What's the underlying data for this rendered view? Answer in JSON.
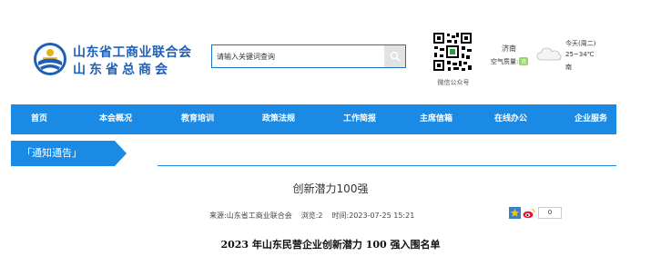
{
  "header": {
    "org_name_line1": "山东省工商业联合会",
    "org_name_line2": "山东省总商会"
  },
  "search": {
    "placeholder": "请输入关键词查询"
  },
  "qr": {
    "caption": "微信公众号"
  },
  "weather": {
    "city": "济南",
    "air_quality_label": "空气质量:",
    "air_quality_value": "良",
    "day": "今天(周二)",
    "temperature": "25~34℃",
    "wind": "南"
  },
  "nav": {
    "items": [
      {
        "label": "首页"
      },
      {
        "label": "本会概况"
      },
      {
        "label": "教育培训"
      },
      {
        "label": "政策法规"
      },
      {
        "label": "工作简报"
      },
      {
        "label": "主席信箱"
      },
      {
        "label": "在线办公"
      },
      {
        "label": "企业服务"
      }
    ]
  },
  "section": {
    "label": "「通知通告」"
  },
  "article": {
    "title": "创新潜力100强",
    "source": "来源:山东省工商业联合会",
    "views": "浏览:2",
    "time": "时间:2023-07-25 15:21",
    "share_count": "0",
    "heading": "2023 年山东民营企业创新潜力 100 强入围名单"
  },
  "colors": {
    "brand_blue": "#1b8ae4",
    "logo_blue": "#1f5fb8",
    "nav_text": "#ffffff"
  },
  "icons": {
    "search": "search-icon",
    "share_qzone": "star-icon",
    "share_weibo": "weibo-icon",
    "weather": "cloud-icon"
  }
}
